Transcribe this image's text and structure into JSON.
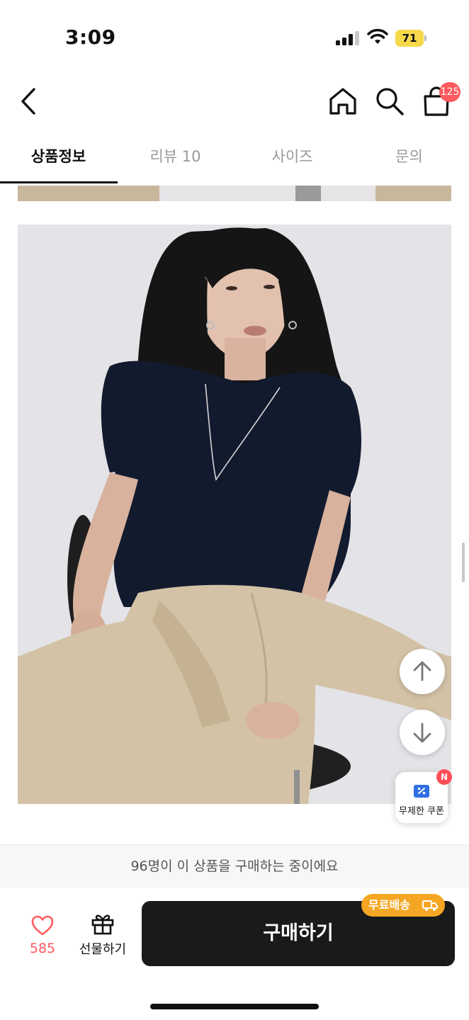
{
  "status_bar": {
    "time": "3:09",
    "battery": "71",
    "icons": [
      "cellular-signal-icon",
      "wifi-icon",
      "battery-icon"
    ]
  },
  "nav": {
    "back_icon": "chevron-left-icon",
    "home_icon": "home-icon",
    "search_icon": "search-icon",
    "cart_icon": "shopping-bag-icon",
    "cart_badge": "125"
  },
  "tabs": [
    {
      "label": "상품정보",
      "active": true
    },
    {
      "label": "리뷰 10",
      "active": false
    },
    {
      "label": "사이즈",
      "active": false
    },
    {
      "label": "문의",
      "active": false
    }
  ],
  "floating": {
    "scroll_up_icon": "arrow-up-icon",
    "scroll_down_icon": "arrow-down-icon",
    "coupon_label": "무제한 쿠폰",
    "coupon_badge": "N"
  },
  "bottom": {
    "buyers_text": "96명이 이 상품을 구매하는 중이에요",
    "like_count": "585",
    "gift_label": "선물하기",
    "buy_label": "구매하기",
    "free_shipping": "무료배송"
  },
  "colors": {
    "accent_red": "#ff5a5f",
    "free_shipping_orange": "#f5a623",
    "buy_button": "#1a1a1a"
  }
}
